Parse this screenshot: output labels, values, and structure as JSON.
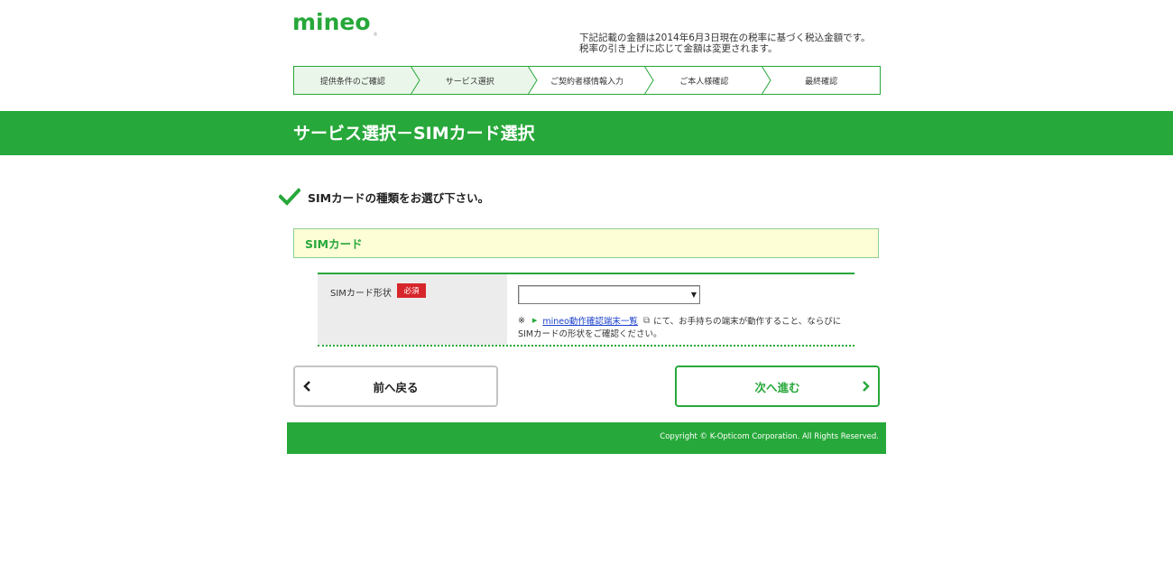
{
  "header": {
    "logo": "mineo",
    "logo_mark": "®",
    "tax_note_line1": "下記記載の金額は2014年6月3日現在の税率に基づく税込金額です。",
    "tax_note_line2": "税率の引き上げに応じて金額は変更されます。"
  },
  "steps": [
    {
      "label": "提供条件のご確認",
      "state": "done"
    },
    {
      "label": "サービス選択",
      "state": "current"
    },
    {
      "label": "ご契約者様情報入力",
      "state": "todo"
    },
    {
      "label": "ご本人様確認",
      "state": "todo"
    },
    {
      "label": "最終確認",
      "state": "todo"
    }
  ],
  "page_title": "サービス選択－SIMカード選択",
  "instruction": "SIMカードの種類をお選び下さい。",
  "section": {
    "title": "SIMカード",
    "field_label": "SIMカード形状",
    "required_badge": "必須",
    "select_value": "",
    "note_mark": "※",
    "note_link": "mineo動作確認端末一覧",
    "note_text_line1": "にて、お手持ちの端末が動作すること、ならびに",
    "note_text_line2": "SIMカードの形状をご確認ください。"
  },
  "buttons": {
    "back_label": "前へ戻る",
    "next_label": "次へ進む"
  },
  "footer": {
    "copyright": "Copyright © K-Opticom Corporation. All Rights Reserved."
  },
  "colors": {
    "brand_green": "#27a83a",
    "required_red": "#d7262b",
    "section_bg": "#fdfdd6"
  }
}
